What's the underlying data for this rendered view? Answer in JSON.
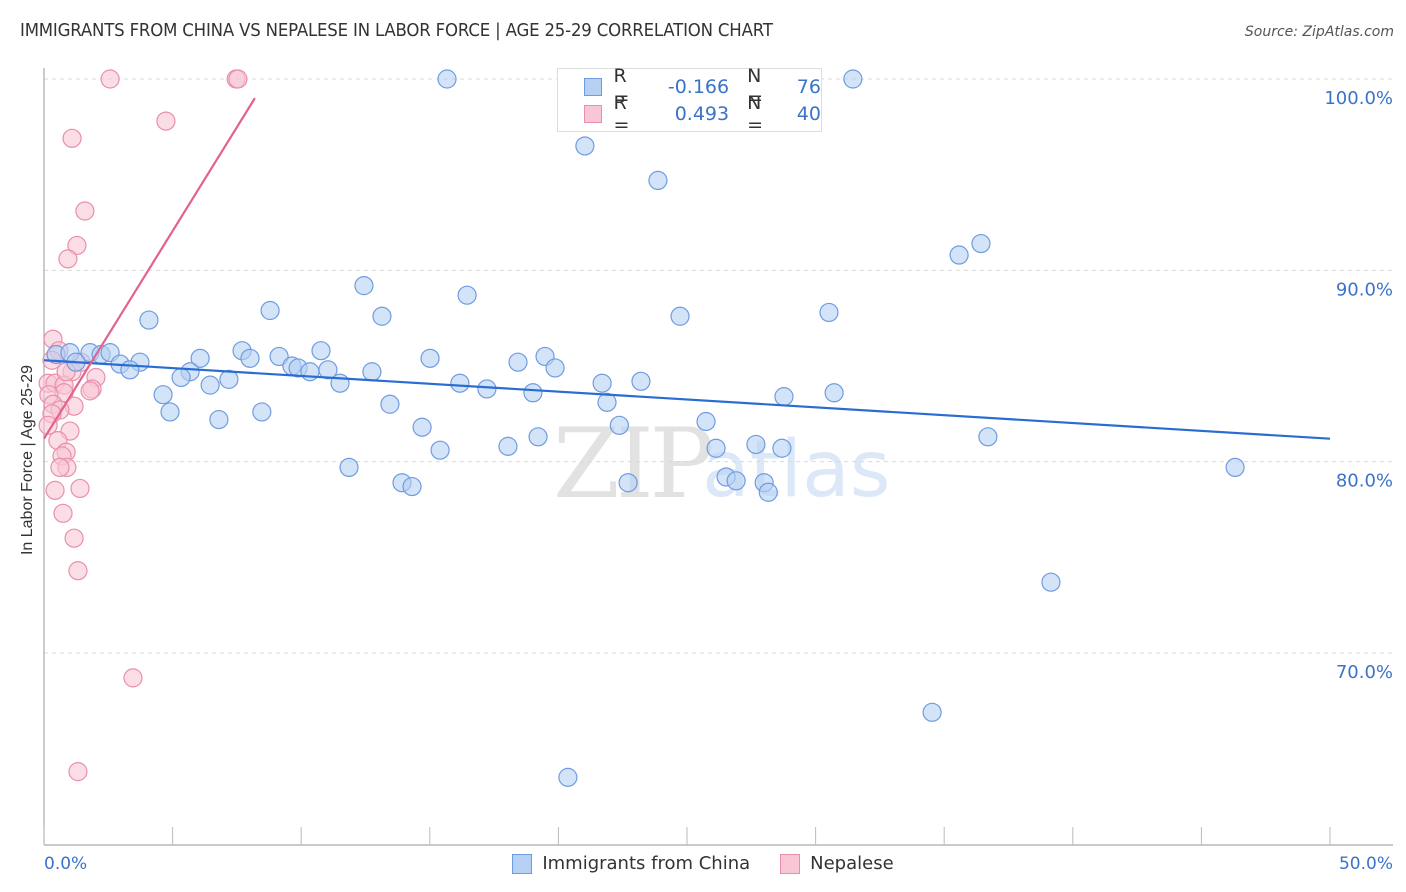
{
  "title": "IMMIGRANTS FROM CHINA VS NEPALESE IN LABOR FORCE | AGE 25-29 CORRELATION CHART",
  "source": "Source: ZipAtlas.com",
  "watermark": {
    "zip": "ZIP",
    "atlas": "atlas"
  },
  "legend": {
    "r_label": "R =",
    "n_label": "N =",
    "china": {
      "r": "-0.166",
      "n": "76"
    },
    "nepalese": {
      "r": "0.493",
      "n": "40"
    }
  },
  "colors": {
    "china_fill": "#b6d0f3",
    "china_stroke": "#6f9ce0",
    "china_line": "#2a6dd2",
    "nepalese_fill": "#f9c6d6",
    "nepalese_stroke": "#e98fab",
    "nepalese_line": "#e2628d",
    "tick_label": "#3b73c8"
  },
  "chart_data": {
    "type": "scatter",
    "title": "IMMIGRANTS FROM CHINA VS NEPALESE IN LABOR FORCE | AGE 25-29 CORRELATION CHART",
    "xlabel": "",
    "ylabel": "In Labor Force | Age 25-29",
    "xlim": [
      0,
      50
    ],
    "ylim": [
      61.5,
      101.5
    ],
    "x_tick_labels": [
      {
        "value": 0,
        "label": "0.0%"
      },
      {
        "value": 50,
        "label": "50.0%"
      }
    ],
    "x_minor_ticks": [
      0,
      5,
      10,
      15,
      20,
      25,
      30,
      35,
      40,
      45,
      50
    ],
    "y_ticks": [
      {
        "value": 100,
        "label": "100.0%"
      },
      {
        "value": 90,
        "label": "90.0%"
      },
      {
        "value": 80,
        "label": "80.0%"
      },
      {
        "value": 70,
        "label": "70.0%"
      }
    ],
    "grid": "horizontal-dashed",
    "legend_position": "top-center",
    "series": [
      {
        "name": "Immigrants from China",
        "r": -0.166,
        "n": 76,
        "trend": {
          "x": [
            0,
            50
          ],
          "y": [
            85.3,
            81.2
          ]
        },
        "points": [
          [
            15.67,
            100.0
          ],
          [
            31.45,
            100.0
          ],
          [
            21.03,
            96.5
          ],
          [
            23.87,
            94.7
          ],
          [
            36.43,
            91.4
          ],
          [
            35.58,
            90.8
          ],
          [
            12.44,
            89.2
          ],
          [
            16.45,
            88.7
          ],
          [
            8.79,
            87.9
          ],
          [
            4.08,
            87.4
          ],
          [
            13.14,
            87.6
          ],
          [
            24.73,
            87.6
          ],
          [
            30.52,
            87.8
          ],
          [
            7.7,
            85.8
          ],
          [
            10.77,
            85.8
          ],
          [
            0.47,
            85.6
          ],
          [
            1.01,
            85.7
          ],
          [
            1.79,
            85.7
          ],
          [
            2.22,
            85.6
          ],
          [
            2.57,
            85.7
          ],
          [
            6.07,
            85.4
          ],
          [
            8.01,
            85.4
          ],
          [
            9.14,
            85.5
          ],
          [
            19.48,
            85.5
          ],
          [
            15.01,
            85.4
          ],
          [
            18.43,
            85.2
          ],
          [
            2.96,
            85.1
          ],
          [
            3.73,
            85.2
          ],
          [
            3.34,
            84.8
          ],
          [
            9.64,
            85.0
          ],
          [
            9.88,
            84.9
          ],
          [
            10.34,
            84.7
          ],
          [
            11.04,
            84.8
          ],
          [
            12.75,
            84.7
          ],
          [
            19.87,
            84.9
          ],
          [
            5.68,
            84.7
          ],
          [
            5.33,
            84.4
          ],
          [
            7.19,
            84.3
          ],
          [
            11.51,
            84.1
          ],
          [
            6.46,
            84.0
          ],
          [
            16.17,
            84.1
          ],
          [
            17.22,
            83.8
          ],
          [
            21.7,
            84.1
          ],
          [
            23.21,
            84.2
          ],
          [
            19.01,
            83.6
          ],
          [
            4.63,
            83.5
          ],
          [
            28.77,
            83.4
          ],
          [
            30.72,
            83.6
          ],
          [
            13.45,
            83.0
          ],
          [
            21.89,
            83.1
          ],
          [
            4.9,
            82.6
          ],
          [
            8.47,
            82.6
          ],
          [
            6.8,
            82.2
          ],
          [
            25.74,
            82.1
          ],
          [
            14.7,
            81.8
          ],
          [
            22.37,
            81.9
          ],
          [
            19.21,
            81.3
          ],
          [
            36.7,
            81.3
          ],
          [
            18.04,
            80.8
          ],
          [
            15.4,
            80.6
          ],
          [
            26.13,
            80.7
          ],
          [
            27.68,
            80.9
          ],
          [
            28.69,
            80.7
          ],
          [
            11.86,
            79.7
          ],
          [
            46.31,
            79.7
          ],
          [
            13.92,
            78.9
          ],
          [
            14.31,
            78.7
          ],
          [
            22.71,
            78.9
          ],
          [
            26.52,
            79.2
          ],
          [
            26.91,
            79.0
          ],
          [
            28.0,
            78.9
          ],
          [
            28.16,
            78.4
          ],
          [
            39.15,
            73.7
          ],
          [
            34.53,
            66.9
          ],
          [
            20.37,
            63.5
          ],
          [
            1.24,
            85.2
          ]
        ]
      },
      {
        "name": "Nepalese",
        "r": 0.493,
        "n": 40,
        "trend": {
          "x": [
            0,
            8.2
          ],
          "y": [
            81.2,
            99.0
          ]
        },
        "points": [
          [
            2.57,
            100.0
          ],
          [
            7.47,
            100.0
          ],
          [
            7.54,
            100.0
          ],
          [
            4.74,
            97.8
          ],
          [
            1.09,
            96.9
          ],
          [
            1.59,
            93.1
          ],
          [
            1.28,
            91.3
          ],
          [
            0.93,
            90.6
          ],
          [
            0.35,
            86.4
          ],
          [
            0.58,
            85.8
          ],
          [
            0.31,
            85.3
          ],
          [
            1.09,
            84.7
          ],
          [
            2.02,
            84.4
          ],
          [
            0.16,
            84.1
          ],
          [
            0.43,
            84.1
          ],
          [
            0.78,
            84.0
          ],
          [
            1.87,
            83.8
          ],
          [
            0.78,
            83.6
          ],
          [
            0.19,
            83.5
          ],
          [
            0.35,
            83.0
          ],
          [
            1.17,
            82.9
          ],
          [
            0.62,
            82.7
          ],
          [
            0.31,
            82.5
          ],
          [
            1.01,
            81.6
          ],
          [
            0.54,
            81.1
          ],
          [
            0.86,
            80.5
          ],
          [
            0.7,
            80.3
          ],
          [
            0.89,
            79.7
          ],
          [
            0.62,
            79.7
          ],
          [
            1.4,
            78.6
          ],
          [
            0.43,
            78.5
          ],
          [
            0.74,
            77.3
          ],
          [
            1.17,
            76.0
          ],
          [
            1.32,
            74.3
          ],
          [
            3.46,
            68.7
          ],
          [
            1.32,
            63.8
          ],
          [
            1.44,
            85.2
          ],
          [
            0.16,
            81.9
          ],
          [
            0.86,
            84.7
          ],
          [
            1.79,
            83.7
          ]
        ]
      }
    ]
  }
}
